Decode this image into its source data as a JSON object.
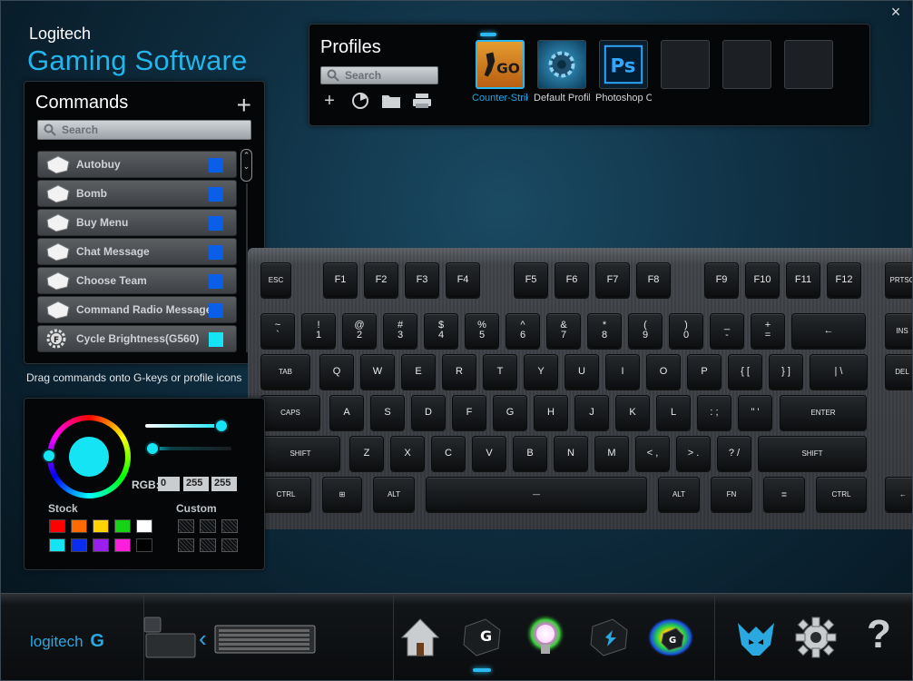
{
  "app": {
    "brand_top": "Logitech",
    "brand_main": "Gaming Software",
    "close": "×"
  },
  "commands": {
    "title": "Commands",
    "add": "+",
    "search_placeholder": "Search",
    "items": [
      {
        "label": "Autobuy",
        "color": "#0a5ee8",
        "icon": "key-icon"
      },
      {
        "label": "Bomb",
        "color": "#0a5ee8",
        "icon": "key-icon"
      },
      {
        "label": "Buy Menu",
        "color": "#0a5ee8",
        "icon": "key-icon"
      },
      {
        "label": "Chat Message",
        "color": "#0a5ee8",
        "icon": "key-icon"
      },
      {
        "label": "Choose Team",
        "color": "#0a5ee8",
        "icon": "key-icon"
      },
      {
        "label": "Command Radio Message",
        "color": "#0a5ee8",
        "icon": "key-icon"
      },
      {
        "label": "Cycle Brightness(G560)",
        "color": "#14e4f4",
        "icon": "gear-f-icon"
      }
    ],
    "hint": "Drag commands onto G-keys or profile icons"
  },
  "profiles": {
    "title": "Profiles",
    "search_placeholder": "Search",
    "items": [
      {
        "label": "Counter-Strike",
        "active": true,
        "icon": "csgo-icon"
      },
      {
        "label": "Default Profile",
        "active": false,
        "icon": "gear-icon"
      },
      {
        "label": "Photoshop CC",
        "active": false,
        "icon": "photoshop-icon"
      },
      {
        "label": "",
        "active": false,
        "icon": "empty"
      },
      {
        "label": "",
        "active": false,
        "icon": "empty"
      },
      {
        "label": "",
        "active": false,
        "icon": "empty"
      }
    ],
    "tools": [
      "add-profile",
      "scan-games",
      "open-folder",
      "print"
    ]
  },
  "keyboard": {
    "row_fn": [
      "ESC",
      "F1",
      "F2",
      "F3",
      "F4",
      "F5",
      "F6",
      "F7",
      "F8",
      "F9",
      "F10",
      "F11",
      "F12",
      "PRTSC"
    ],
    "row_num": [
      {
        "top": "~",
        "bot": "`"
      },
      {
        "top": "!",
        "bot": "1"
      },
      {
        "top": "@",
        "bot": "2"
      },
      {
        "top": "#",
        "bot": "3"
      },
      {
        "top": "$",
        "bot": "4"
      },
      {
        "top": "%",
        "bot": "5"
      },
      {
        "top": "^",
        "bot": "6"
      },
      {
        "top": "&",
        "bot": "7"
      },
      {
        "top": "*",
        "bot": "8"
      },
      {
        "top": "(",
        "bot": "9"
      },
      {
        "top": ")",
        "bot": "0"
      },
      {
        "top": "_",
        "bot": "-"
      },
      {
        "top": "+",
        "bot": "="
      },
      {
        "top": "←",
        "bot": ""
      },
      {
        "top": "INS",
        "bot": ""
      }
    ],
    "row_q": [
      "TAB",
      "Q",
      "W",
      "E",
      "R",
      "T",
      "Y",
      "U",
      "I",
      "O",
      "P",
      "{ [",
      "} ]",
      "| \\",
      "DEL"
    ],
    "row_a": [
      "CAPS",
      "A",
      "S",
      "D",
      "F",
      "G",
      "H",
      "J",
      "K",
      "L",
      ": ;",
      "\" '",
      "ENTER"
    ],
    "row_z": [
      "SHIFT",
      "Z",
      "X",
      "C",
      "V",
      "B",
      "N",
      "M",
      "< ,",
      "> .",
      "? /",
      "SHIFT"
    ],
    "row_ctrl": [
      "CTRL",
      "⊞",
      "ALT",
      "—",
      "ALT",
      "FN",
      "≣",
      "CTRL",
      "←"
    ]
  },
  "color": {
    "rgb_label": "RGB:",
    "r": "0",
    "g": "255",
    "b": "255",
    "current": "#14e4f4",
    "brightness": 0.9,
    "stock_label": "Stock",
    "custom_label": "Custom",
    "stock_colors": [
      "#ff0000",
      "#ff6a00",
      "#ffd400",
      "#16d316",
      "#ffffff",
      "#14e4f4",
      "#0a2df0",
      "#9b1ef0",
      "#ff1edc",
      "#000000"
    ]
  },
  "bottom": {
    "logo": "logitech",
    "tools": [
      "home-icon",
      "g-key-icon",
      "lighting-icon",
      "spark-key-icon",
      "heatmap-icon"
    ],
    "right": [
      "arx-icon",
      "settings-icon",
      "help-icon"
    ]
  }
}
